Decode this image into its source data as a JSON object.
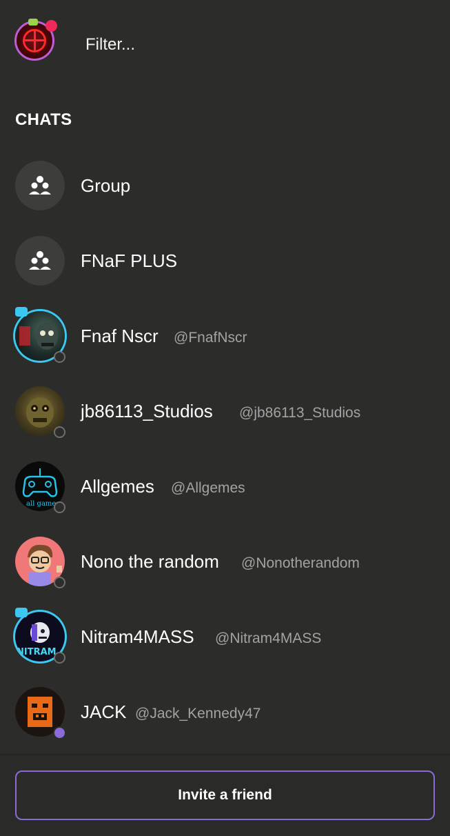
{
  "header": {
    "filter_placeholder": "Filter..."
  },
  "section": {
    "title": "CHATS"
  },
  "chats": [
    {
      "name": "Group",
      "handle": "",
      "type": "group"
    },
    {
      "name": "FNaF PLUS",
      "handle": "",
      "type": "group"
    },
    {
      "name": "Fnaf Nscr",
      "handle": "@FnafNscr",
      "type": "user",
      "status": "offline"
    },
    {
      "name": "jb86113_Studios",
      "handle": "@jb86113_Studios",
      "type": "user",
      "status": "offline"
    },
    {
      "name": "Allgemes",
      "handle": "@Allgemes",
      "type": "user",
      "status": "offline"
    },
    {
      "name": "Nono the random",
      "handle": "@Nonotherandom",
      "type": "user",
      "status": "offline"
    },
    {
      "name": "Nitram4MASS",
      "handle": "@Nitram4MASS",
      "type": "user",
      "status": "offline"
    },
    {
      "name": "JACK",
      "handle": "@Jack_Kennedy47",
      "type": "user",
      "status": "online"
    }
  ],
  "footer": {
    "invite_label": "Invite a friend"
  },
  "colors": {
    "background": "#2c2c2a",
    "accent": "#8a6bd8",
    "notification": "#ef2a5a",
    "handle_text": "#a3a3a3"
  }
}
